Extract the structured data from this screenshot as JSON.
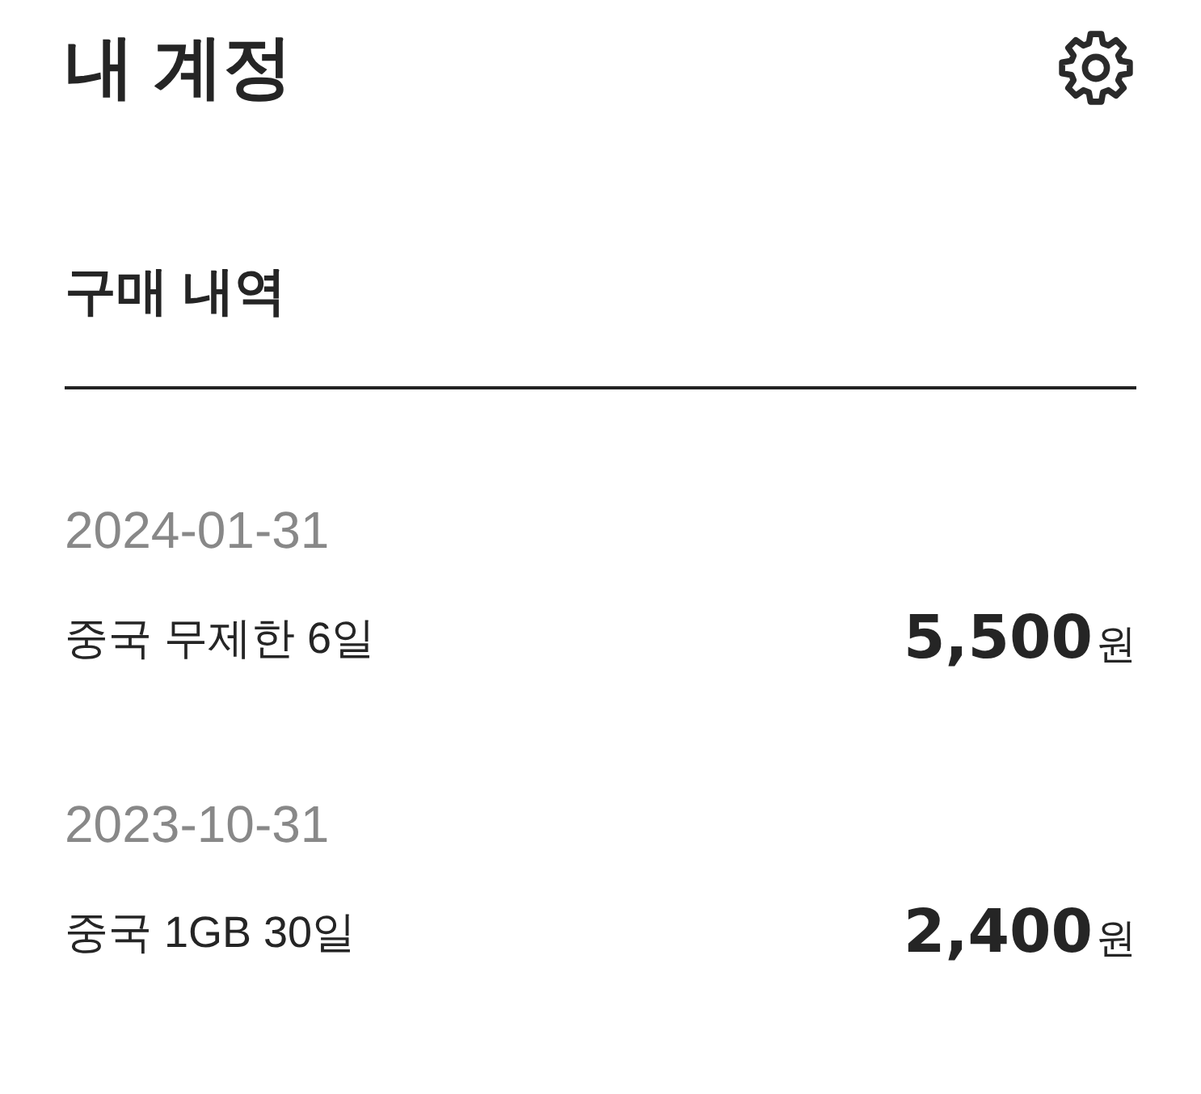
{
  "header": {
    "title": "내 계정"
  },
  "section": {
    "title": "구매 내역"
  },
  "purchases": [
    {
      "date": "2024-01-31",
      "name": "중국 무제한 6일",
      "amount": "5,500",
      "unit": "원"
    },
    {
      "date": "2023-10-31",
      "name": "중국 1GB 30일",
      "amount": "2,400",
      "unit": "원"
    }
  ]
}
